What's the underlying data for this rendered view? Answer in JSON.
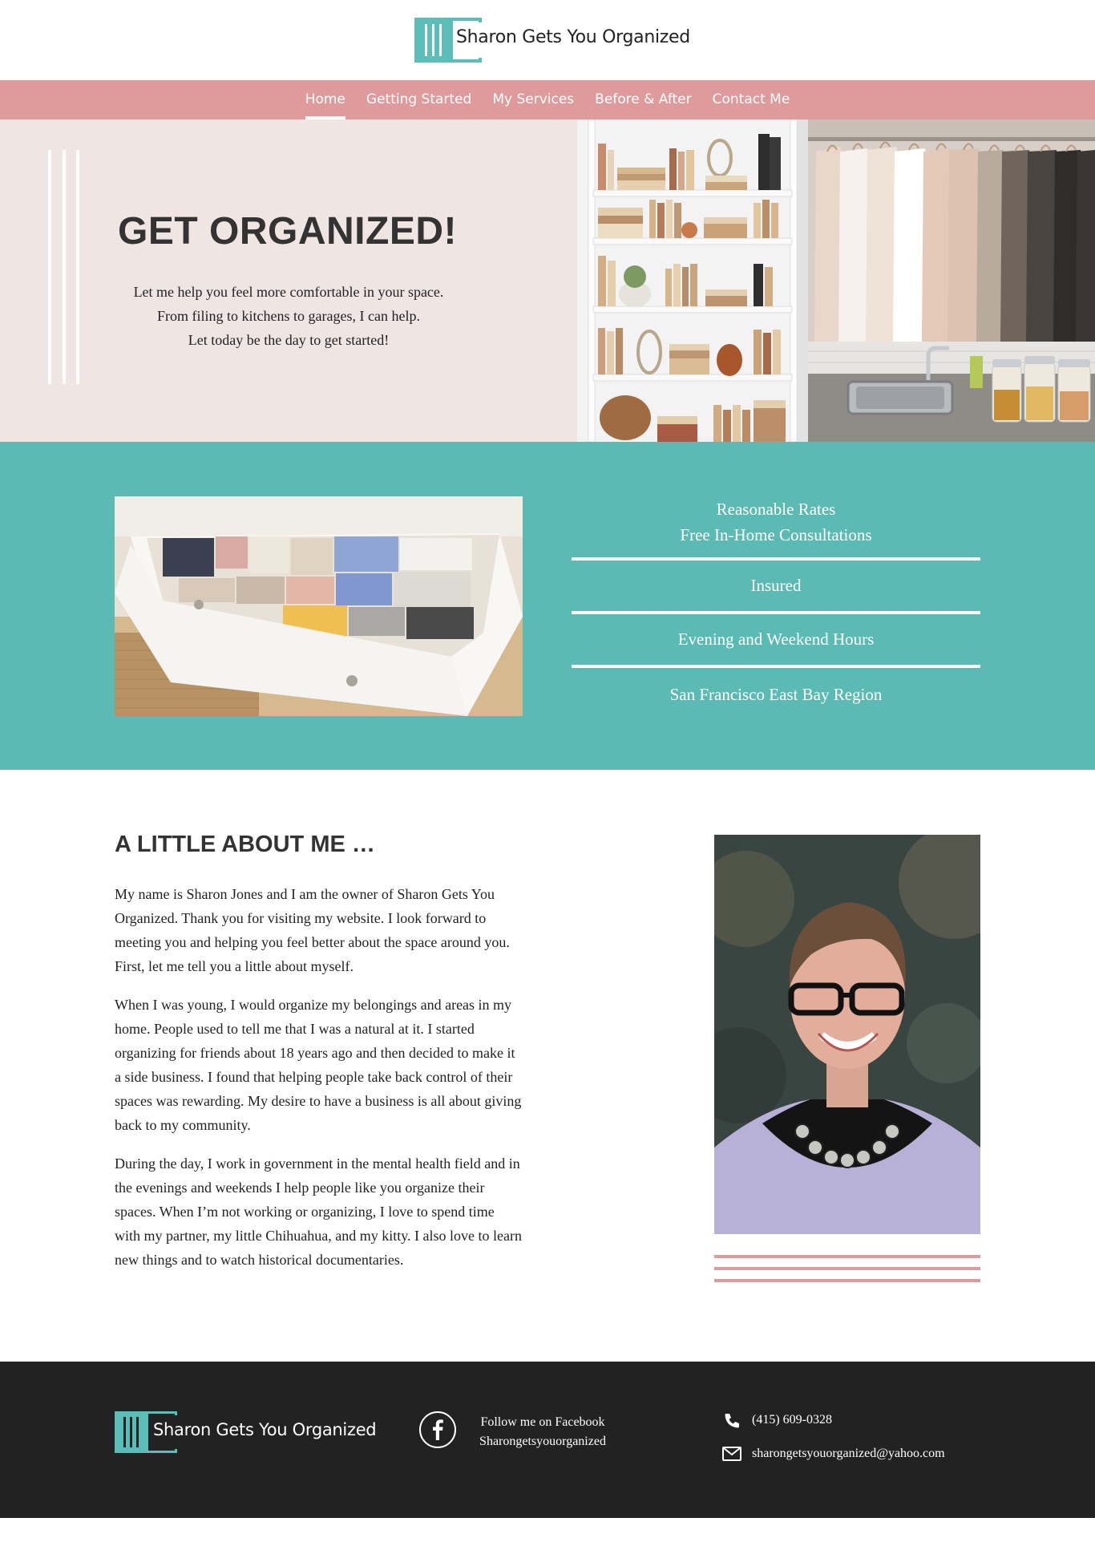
{
  "brand": {
    "name": "Sharon Gets You Organized",
    "accent_color": "#5bbdb7",
    "pink_color": "#df9a9c",
    "hero_bg": "#efe5e3",
    "footer_bg": "#222222"
  },
  "nav": {
    "items": [
      {
        "label": "Home",
        "active": true
      },
      {
        "label": "Getting Started"
      },
      {
        "label": "My Services"
      },
      {
        "label": "Before & After"
      },
      {
        "label": "Contact Me"
      }
    ]
  },
  "hero": {
    "title": "GET ORGANIZED!",
    "lines": [
      "Let me help you feel more comfortable in your space.",
      "From filing to kitchens to garages, I can help.",
      "Let today be the day to get started!"
    ],
    "images": [
      "bookshelf",
      "closet",
      "kitchen"
    ]
  },
  "features": {
    "items": [
      "Reasonable Rates",
      "Free In-Home Consultations",
      "Insured",
      "Evening and Weekend Hours",
      "San Francisco East Bay Region"
    ]
  },
  "about": {
    "title": "A LITTLE ABOUT ME …",
    "paragraphs": [
      "My name is Sharon Jones and I am the owner of Sharon Gets You Organized. Thank you for visiting my website. I look forward to meeting you and helping you feel better about the space around you. First, let me tell you a little about myself.",
      "When I was young, I would organize my belongings and areas in my home. People used to tell me that I was a natural at it. I started organizing for friends about 18 years ago and then decided to make it a side business. I found that helping people take back control of their spaces was rewarding. My desire to have a business is all about giving back to my community.",
      "During the day, I work in government in the mental health field and in the evenings and weekends I help people like you organize their spaces. When I’m not working or organizing, I love to spend time with my partner, my little Chihuahua, and my kitty. I also love to learn new things and to watch historical documentaries."
    ]
  },
  "footer": {
    "brand": "Sharon Gets You Organized",
    "facebook_line1": "Follow me on Facebook",
    "facebook_line2": "Sharongetsyouorganized",
    "phone": "(415) 609-0328",
    "email": "sharongetsyouorganized@yahoo.com",
    "icons": [
      "facebook-icon",
      "phone-icon",
      "email-icon"
    ]
  }
}
